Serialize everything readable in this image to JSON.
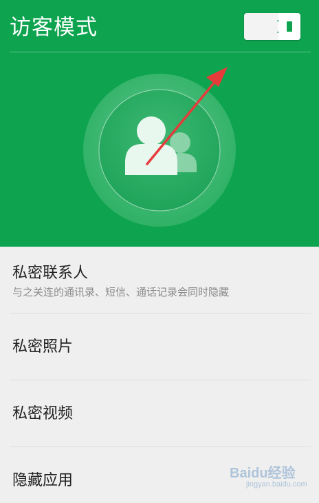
{
  "header": {
    "title": "访客模式",
    "accent_color": "#0ea44f",
    "toggle": {
      "state": "on",
      "icon": "toggle-switch"
    },
    "center_icon": "guest-users-icon",
    "annotation": "red-arrow-pointing-to-toggle"
  },
  "list": {
    "items": [
      {
        "label": "私密联系人",
        "subtitle": "与之关连的通讯录、短信、通话记录会同时隐藏"
      },
      {
        "label": "私密照片"
      },
      {
        "label": "私密视频"
      },
      {
        "label": "隐藏应用"
      }
    ]
  },
  "watermark": {
    "brand": "Baidu经验",
    "site": "jingyan.baidu.com"
  }
}
